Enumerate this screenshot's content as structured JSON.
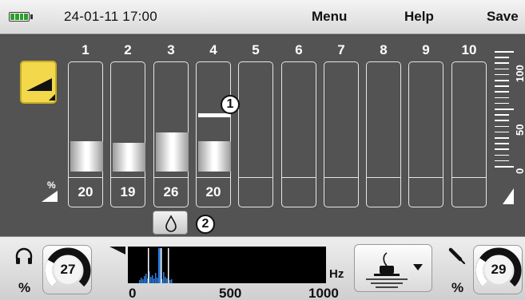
{
  "topbar": {
    "datetime": "24-01-11 17:00",
    "menu_label": "Menu",
    "help_label": "Help",
    "save_label": "Save",
    "battery_icon": "battery-full-icon"
  },
  "mode_button": {
    "icon": "volume-ramp-icon"
  },
  "percent_label": "%",
  "channels": [
    {
      "number": "1",
      "value": "20",
      "level": 0.2
    },
    {
      "number": "2",
      "value": "19",
      "level": 0.19
    },
    {
      "number": "3",
      "value": "26",
      "level": 0.26
    },
    {
      "number": "4",
      "value": "20",
      "level": 0.2,
      "marker": 0.56
    },
    {
      "number": "5",
      "value": "",
      "level": 0
    },
    {
      "number": "6",
      "value": "",
      "level": 0
    },
    {
      "number": "7",
      "value": "",
      "level": 0
    },
    {
      "number": "8",
      "value": "",
      "level": 0
    },
    {
      "number": "9",
      "value": "",
      "level": 0
    },
    {
      "number": "10",
      "value": "",
      "level": 0
    }
  ],
  "callouts": [
    "1",
    "2"
  ],
  "filter_button": {
    "icon": "water-drop-icon"
  },
  "scale": {
    "labels": [
      "100",
      "50",
      "0"
    ]
  },
  "bottom": {
    "headphone": {
      "icon": "headphones-icon",
      "percent_label": "%",
      "value": "27",
      "level": 0.27
    },
    "microphone": {
      "icon": "microphone-icon",
      "percent_label": "%",
      "value": "29",
      "level": 0.29
    },
    "spectrum": {
      "unit_label": "Hz",
      "tick_labels": [
        "0",
        "500",
        "1000"
      ],
      "x_range": [
        0,
        1000
      ]
    },
    "sensor_button": {
      "icon": "ground-sensor-icon",
      "dropdown_icon": "triangle-down-icon"
    }
  },
  "colors": {
    "accent_yellow": "#f2d84a",
    "spectrum_blue": "#2f7fe0",
    "battery_green": "#2e9e2e"
  }
}
